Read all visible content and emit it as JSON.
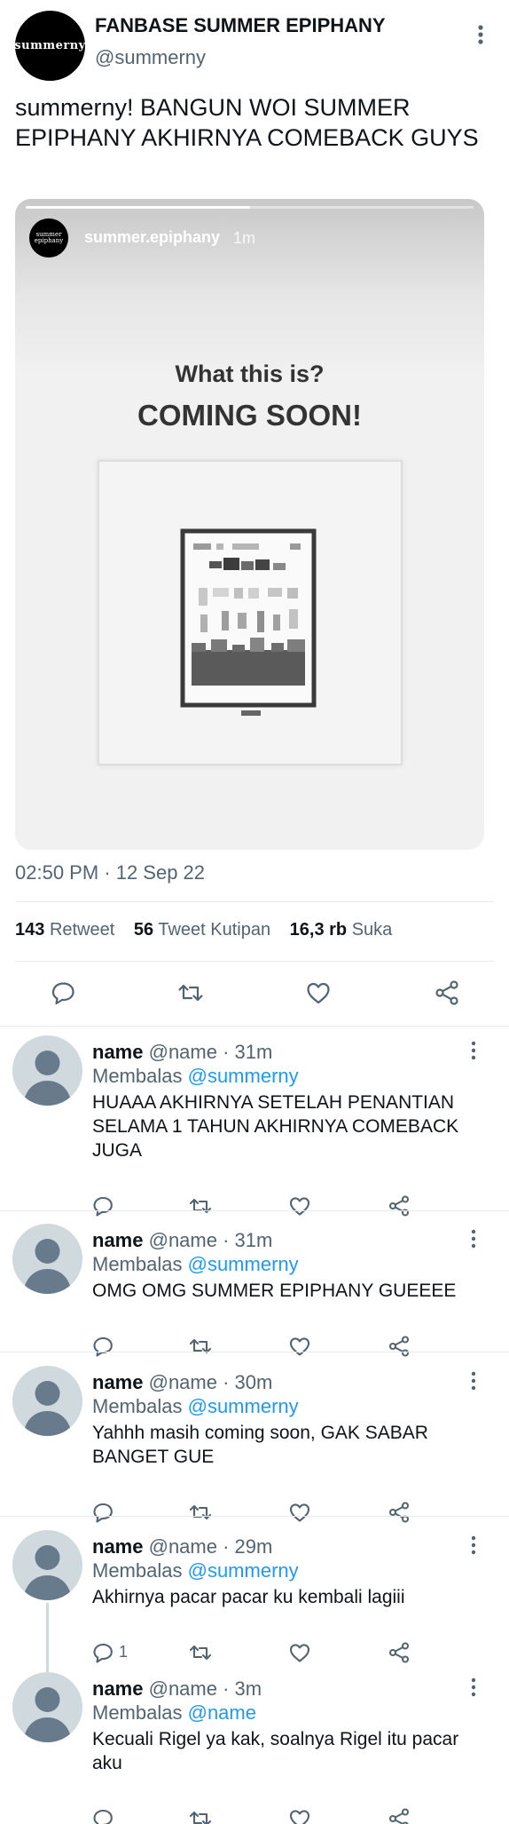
{
  "main_tweet": {
    "display_name": "FANBASE SUMMER EPIPHANY",
    "handle": "@summerny",
    "avatar_text": "summerny",
    "text": "summerny! BANGUN WOI SUMMER EPIPHANY AKHIRNYA COMEBACK GUYS",
    "media": {
      "type": "instagram-story",
      "progress": 0.5,
      "avatar_text": "summer epiphany",
      "username": "summer.epiphany",
      "time": "1m",
      "heading": "What this is?",
      "headline": "COMING SOON!",
      "card": "pixelated-image"
    },
    "timestamp": "02:50 PM · 12 Sep 22",
    "stats": [
      {
        "count": "143",
        "label": "Retweet"
      },
      {
        "count": "56",
        "label": "Tweet Kutipan"
      },
      {
        "count": "16,3 rb",
        "label": "Suka"
      }
    ],
    "actions": [
      {
        "name": "reply",
        "icon": "comment-icon"
      },
      {
        "name": "retweet",
        "icon": "retweet-icon"
      },
      {
        "name": "like",
        "icon": "heart-icon"
      },
      {
        "name": "share",
        "icon": "share-icon"
      }
    ]
  },
  "replies": [
    {
      "name": "name",
      "handle": "@name",
      "time": "· 31m",
      "replying_prefix": "Membalas",
      "replying_to": "@summerny",
      "text": "HUAAA AKHIRNYA SETELAH PENANTIAN SELAMA 1 TAHUN AKHIRNYA COMEBACK JUGA",
      "reply_count": ""
    },
    {
      "name": "name",
      "handle": "@name",
      "time": "· 31m",
      "replying_prefix": "Membalas",
      "replying_to": "@summerny",
      "text": "OMG OMG SUMMER EPIPHANY GUEEEE",
      "reply_count": ""
    },
    {
      "name": "name",
      "handle": "@name",
      "time": "· 30m",
      "replying_prefix": "Membalas",
      "replying_to": "@summerny",
      "text": "Yahhh masih coming soon, GAK SABAR BANGET GUE",
      "reply_count": ""
    },
    {
      "name": "name",
      "handle": "@name",
      "time": "· 29m",
      "replying_prefix": "Membalas",
      "replying_to": "@summerny",
      "text": "Akhirnya pacar pacar ku kembali lagiii",
      "reply_count": "1"
    },
    {
      "name": "name",
      "handle": "@name",
      "time": "· 3m",
      "replying_prefix": "Membalas",
      "replying_to": "@name",
      "text": "Kecuali Rigel ya kak, soalnya Rigel itu pacar aku",
      "reply_count": ""
    }
  ],
  "colors": {
    "text": "#0f1419",
    "secondary": "#536471",
    "link": "#1d9bf0",
    "divider": "#e6ecf0",
    "avatar_placeholder": "#cfd9de"
  }
}
